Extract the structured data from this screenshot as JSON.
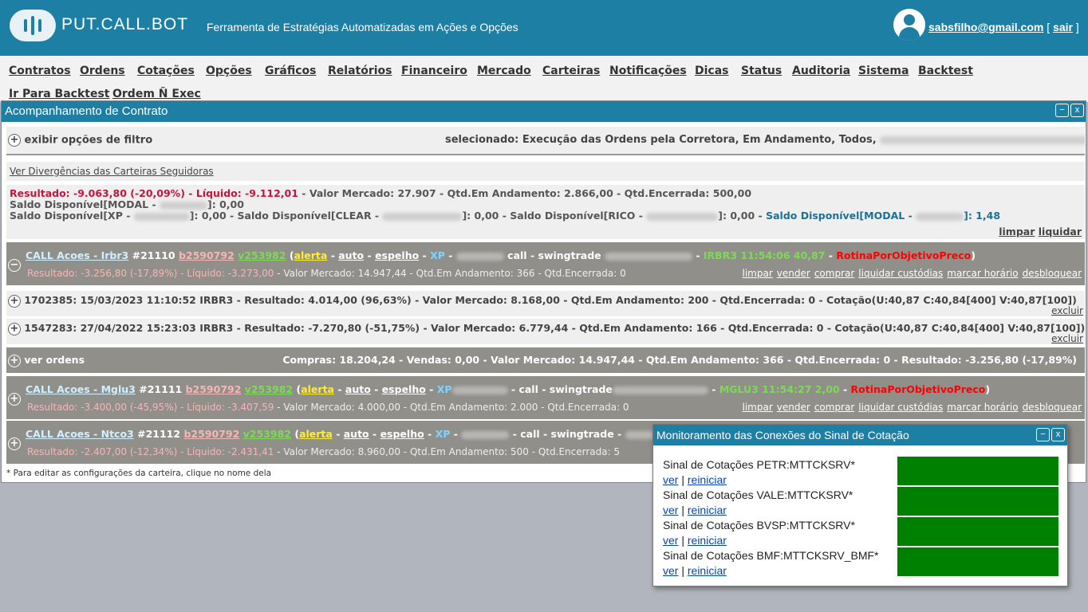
{
  "header": {
    "logo_text": "PUT.CALL.BOT",
    "tagline": "Ferramenta de Estratégias Automatizadas em Ações e Opções",
    "user_email": "sabsfilho@gmail.com",
    "logout_label": "sair",
    "bracket_open": "[",
    "bracket_close": "]"
  },
  "nav": {
    "items": [
      "Contratos",
      "Ordens",
      "Cotações",
      "Opções",
      "Gráficos",
      "Relatórios",
      "Financeiro",
      "Mercado",
      "Carteiras",
      "Notificações",
      "Dicas",
      "Status",
      "Auditoria",
      "Sistema",
      "Backtest",
      "Ir Para Backtest",
      "Ordem Ñ Exec"
    ]
  },
  "window": {
    "title": "Acompanhamento de Contrato",
    "minimize": "−",
    "close": "x",
    "filter_toggle": "exibir opções de filtro",
    "filter_selected": "selecionado: Execução das Ordens pela Corretora, Em Andamento, Todos,",
    "divergencias_link": "Ver Divergências das Carteiras Seguidoras",
    "summary": {
      "line1_red": "Resultado: -9.063,80 (-20,09%) - Líquido: -9.112,01",
      "line1_rest": " - Valor Mercado: 27.907 - Qtd.Em Andamento: 2.866,00 - Qtd.Encerrada: 500,00",
      "line2a": "Saldo Disponível[MODAL - ",
      "line2b": "]: 0,00",
      "line3a": "Saldo Disponível[XP - ",
      "line3b": "]: 0,00 - Saldo Disponível[CLEAR - ",
      "line3c": "]: 0,00 - Saldo Disponível[RICO - ",
      "line3d": "]: 0,00 - ",
      "line3e": "Saldo Disponível[MODAL - ",
      "line3f": "]: 1,48",
      "limpar": "limpar",
      "liquidar": "liquidar"
    },
    "contracts": [
      {
        "name": "CALL Acoes - Irbr3",
        "id": "#21110",
        "b": "b2590792",
        "v": "v253982",
        "alerta": "alerta",
        "auto": "auto",
        "espelho": "espelho",
        "broker": "XP",
        "call": "call",
        "swing": "swingtrade",
        "quote": "IRBR3 11:54:06 40,87",
        "rotina": "RotinaPorObjetivoPreco",
        "result": "Resultado: -3.256,80 (-17,89%) - Líquido: -3.273,00",
        "rest": " - Valor Mercado: 14.947,44 - Qtd.Em Andamento: 366 - Qtd.Encerrada: 0"
      },
      {
        "name": "CALL Acoes - Mglu3",
        "id": "#21111",
        "b": "b2590792",
        "v": "v253982",
        "alerta": "alerta",
        "auto": "auto",
        "espelho": "espelho",
        "broker": "XP",
        "call": "call",
        "swing": "swingtrade",
        "quote": "MGLU3 11:54:27 2,00",
        "rotina": "RotinaPorObjetivoPreco",
        "result": "Resultado: -3.400,00 (-45,95%) - Líquido: -3.407,59",
        "rest": " - Valor Mercado: 4.000,00 - Qtd.Em Andamento: 2.000 - Qtd.Encerrada: 0"
      },
      {
        "name": "CALL Acoes - Ntco3",
        "id": "#21112",
        "b": "b2590792",
        "v": "v253982",
        "alerta": "alerta",
        "auto": "auto",
        "espelho": "espelho",
        "broker": "XP",
        "call": "call",
        "swing": "swingtrade",
        "quote": "",
        "rotina": "",
        "result": "Resultado: -2.407,00 (-12,34%) - Líquido: -2.431,41",
        "rest": " - Valor Mercado: 8.960,00 - Qtd.Em Andamento: 500 - Qtd.Encerrada: 5"
      }
    ],
    "actions": [
      "limpar",
      "vender",
      "comprar",
      "liquidar custódias",
      "marcar horário",
      "desbloquear"
    ],
    "orders": [
      {
        "text": "1702385: 15/03/2023 11:10:52 IRBR3 - Resultado: 4.014,00 (96,63%) - Valor Mercado: 8.168,00 - Qtd.Em Andamento: 200 - Qtd.Encerrada: 0 - Cotação(U:40,87 C:40,84[400] V:40,87[100])",
        "excluir": "excluir"
      },
      {
        "text": "1547283: 27/04/2022 15:23:03 IRBR3 - Resultado: -7.270,80 (-51,75%) - Valor Mercado: 6.779,44 - Qtd.Em Andamento: 166 - Qtd.Encerrada: 0 - Cotação(U:40,87 C:40,84[400] V:40,87[100])",
        "excluir": "excluir"
      }
    ],
    "ver_ordens": {
      "label": "ver ordens",
      "summary": "Compras: 18.204,24 - Vendas: 0,00 - Valor Mercado: 14.947,44 - Qtd.Em Andamento: 366 - Qtd.Encerrada: 0 - Resultado: -3.256,80 (-17,89%)"
    },
    "footnote": "* Para editar as configurações da carteira, clique no nome dela"
  },
  "popup": {
    "title": "Monitoramento das Conexões do Sinal de Cotação",
    "minimize": "−",
    "close": "x",
    "signals": [
      {
        "name": "Sinal de Cotações PETR:MTTCKSRV*",
        "ver": "ver",
        "sep": "|",
        "reiniciar": "reiniciar"
      },
      {
        "name": "Sinal de Cotações VALE:MTTCKSRV*",
        "ver": "ver",
        "sep": "|",
        "reiniciar": "reiniciar"
      },
      {
        "name": "Sinal de Cotações BVSP:MTTCKSRV*",
        "ver": "ver",
        "sep": "|",
        "reiniciar": "reiniciar"
      },
      {
        "name": "Sinal de Cotações BMF:MTTCKSRV_BMF*",
        "ver": "ver",
        "sep": "|",
        "reiniciar": "reiniciar"
      }
    ],
    "status_color": "#008000"
  }
}
